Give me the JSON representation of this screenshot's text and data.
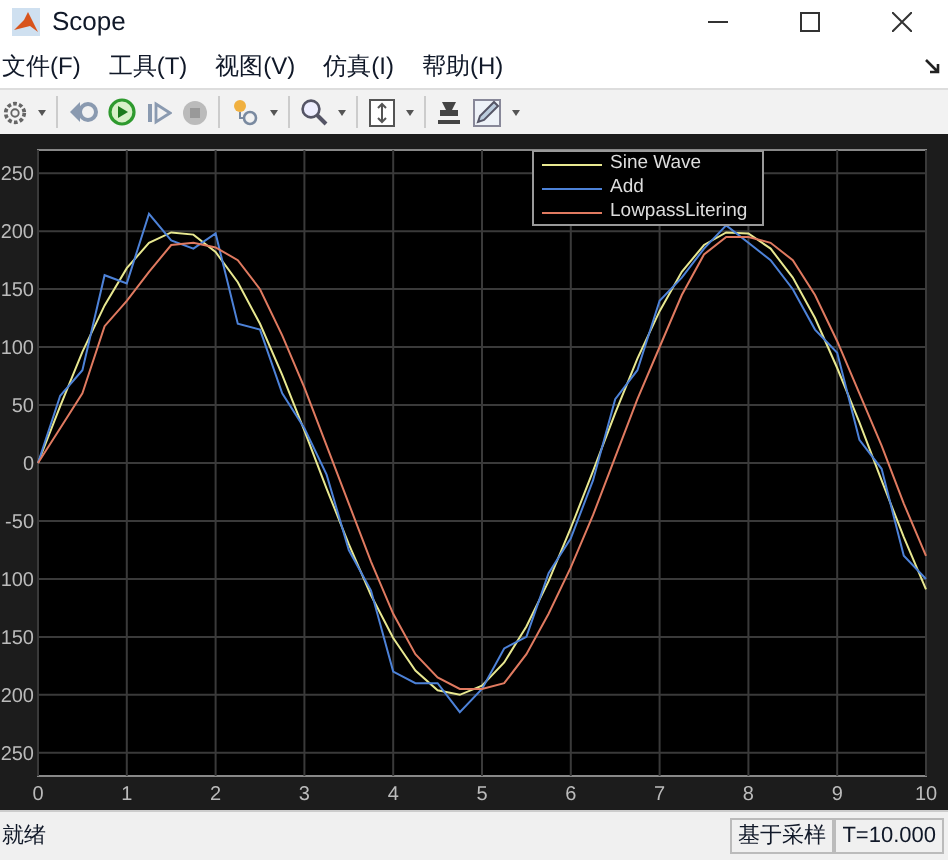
{
  "window": {
    "title": "Scope"
  },
  "menu": [
    {
      "label": "文件(F)"
    },
    {
      "label": "工具(T)"
    },
    {
      "label": "视图(V)"
    },
    {
      "label": "仿真(I)"
    },
    {
      "label": "帮助(H)"
    }
  ],
  "chart_data": {
    "type": "line",
    "x": [
      0,
      0.25,
      0.5,
      0.75,
      1,
      1.25,
      1.5,
      1.75,
      2,
      2.25,
      2.5,
      2.75,
      3,
      3.25,
      3.5,
      3.75,
      4,
      4.25,
      4.5,
      4.75,
      5,
      5.25,
      5.5,
      5.75,
      6,
      6.25,
      6.5,
      6.75,
      7,
      7.25,
      7.5,
      7.75,
      8,
      8.25,
      8.5,
      8.75,
      9,
      9.25,
      9.5,
      9.75,
      10
    ],
    "series": [
      {
        "name": "Sine Wave",
        "color": "#e8e890",
        "values": [
          0,
          49,
          96,
          136,
          168,
          190,
          199,
          197,
          182,
          156,
          120,
          76,
          28,
          -22,
          -70,
          -114,
          -151,
          -179,
          -196,
          -200,
          -192,
          -172,
          -141,
          -102,
          -56,
          -7,
          43,
          90,
          131,
          165,
          188,
          199,
          198,
          185,
          160,
          125,
          82,
          35,
          -15,
          -64,
          -109
        ]
      },
      {
        "name": "Add",
        "color": "#4d82d8",
        "values": [
          0,
          58,
          80,
          162,
          155,
          215,
          192,
          185,
          198,
          120,
          115,
          60,
          30,
          -10,
          -75,
          -110,
          -180,
          -190,
          -190,
          -215,
          -195,
          -160,
          -150,
          -95,
          -65,
          -15,
          55,
          80,
          140,
          160,
          185,
          205,
          190,
          175,
          150,
          115,
          95,
          20,
          -5,
          -80,
          -100
        ]
      },
      {
        "name": "LowpassLitering",
        "color": "#e07a60",
        "values": [
          0,
          30,
          60,
          118,
          140,
          165,
          188,
          190,
          186,
          175,
          150,
          110,
          65,
          15,
          -35,
          -85,
          -130,
          -165,
          -185,
          -195,
          -195,
          -190,
          -165,
          -130,
          -90,
          -45,
          5,
          55,
          100,
          145,
          180,
          195,
          195,
          190,
          175,
          145,
          105,
          60,
          15,
          -35,
          -80
        ]
      }
    ],
    "grid": true,
    "legend": true,
    "xlim": [
      0,
      10
    ],
    "ylim": [
      -270,
      270
    ],
    "xticks": [
      0,
      1,
      2,
      3,
      4,
      5,
      6,
      7,
      8,
      9,
      10
    ],
    "yticks": [
      {
        "value": 250,
        "label": "250"
      },
      {
        "value": 200,
        "label": "200"
      },
      {
        "value": 150,
        "label": "150"
      },
      {
        "value": 100,
        "label": "100"
      },
      {
        "value": 50,
        "label": "50"
      },
      {
        "value": 0,
        "label": "0"
      },
      {
        "value": -50,
        "label": "-50"
      },
      {
        "value": -100,
        "label": "100"
      },
      {
        "value": -150,
        "label": "150"
      },
      {
        "value": -200,
        "label": "200"
      },
      {
        "value": -250,
        "label": "250"
      }
    ]
  },
  "status_bar": {
    "message": "就绪",
    "mode": "基于采样",
    "time": "T=10.000"
  }
}
